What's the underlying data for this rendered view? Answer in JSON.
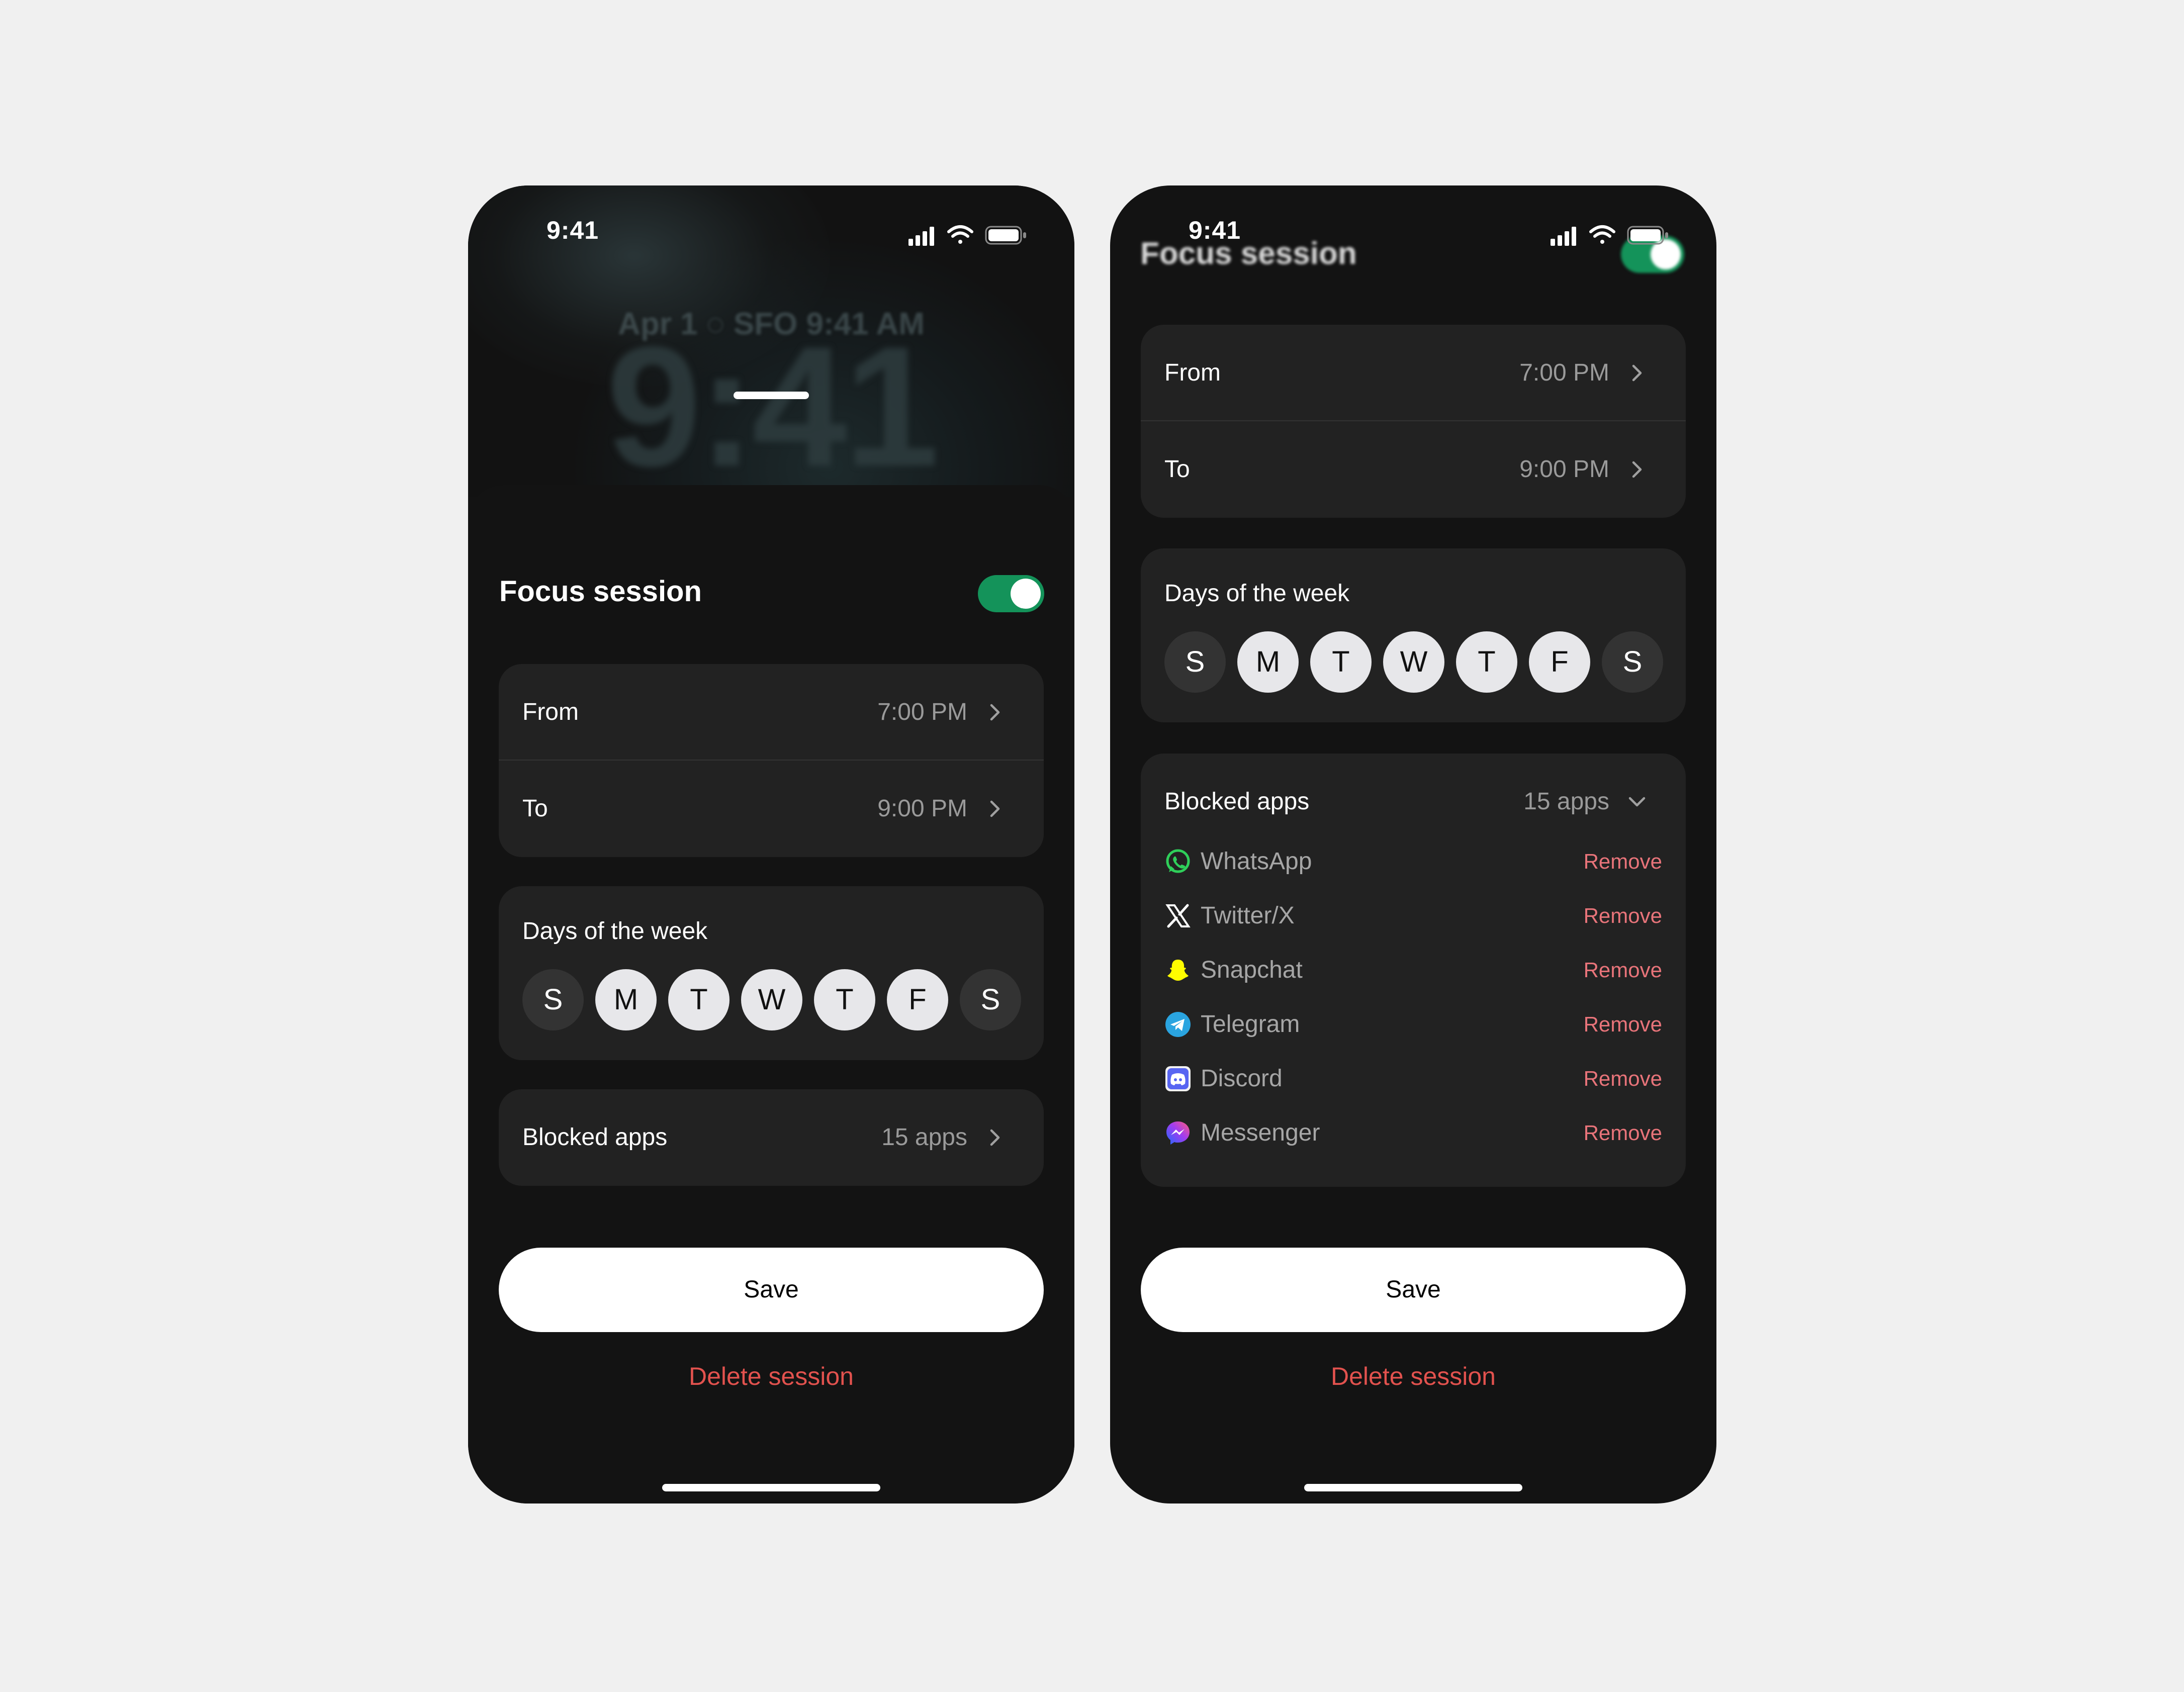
{
  "status_bar": {
    "time": "9:41"
  },
  "lockscreen": {
    "date_line": "Apr 1 ◌ SFO 9:41 AM",
    "clock": "9:41"
  },
  "sheet": {
    "title": "Focus session",
    "toggle_on": true,
    "from": {
      "label": "From",
      "value": "7:00 PM"
    },
    "to": {
      "label": "To",
      "value": "9:00 PM"
    },
    "days": {
      "label": "Days of the week",
      "items": [
        {
          "letter": "S",
          "selected": false
        },
        {
          "letter": "M",
          "selected": true
        },
        {
          "letter": "T",
          "selected": true
        },
        {
          "letter": "W",
          "selected": true
        },
        {
          "letter": "T",
          "selected": true
        },
        {
          "letter": "F",
          "selected": true
        },
        {
          "letter": "S",
          "selected": false
        }
      ]
    },
    "blocked": {
      "label": "Blocked apps",
      "value": "15 apps"
    },
    "save_label": "Save",
    "delete_label": "Delete session"
  },
  "expanded_apps": {
    "remove_label": "Remove",
    "items": [
      {
        "name": "WhatsApp",
        "icon": "whatsapp-icon"
      },
      {
        "name": "Twitter/X",
        "icon": "x-icon"
      },
      {
        "name": "Snapchat",
        "icon": "snapchat-icon"
      },
      {
        "name": "Telegram",
        "icon": "telegram-icon"
      },
      {
        "name": "Discord",
        "icon": "discord-icon"
      },
      {
        "name": "Messenger",
        "icon": "messenger-icon"
      }
    ]
  },
  "colors": {
    "accent_green": "#14935a",
    "danger": "#e2524e",
    "remove": "#e8747a",
    "card": "#222222",
    "sheet": "#131313"
  }
}
